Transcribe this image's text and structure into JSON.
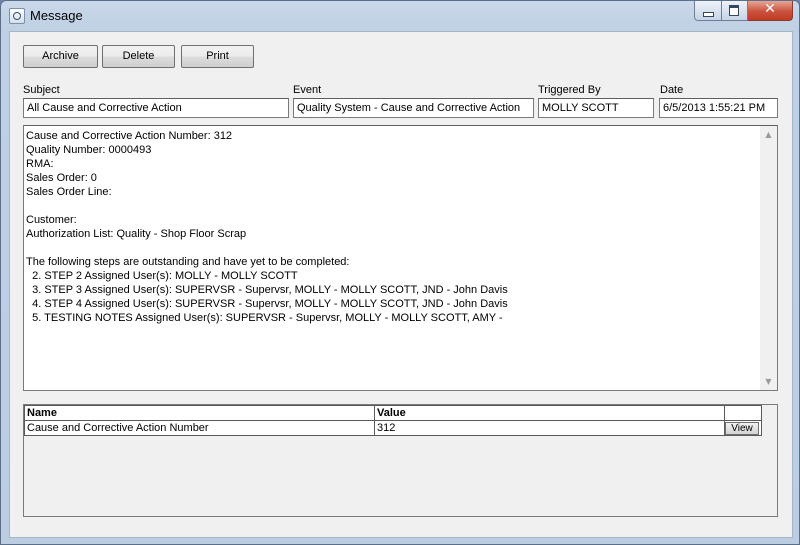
{
  "window": {
    "title": "Message",
    "close_glyph": "✕"
  },
  "toolbar": {
    "archive_label": "Archive",
    "delete_label": "Delete",
    "print_label": "Print"
  },
  "fields": {
    "subject": {
      "label": "Subject",
      "value": "All Cause and Corrective Action"
    },
    "event": {
      "label": "Event",
      "value": "Quality System - Cause and Corrective Action"
    },
    "triggered_by": {
      "label": "Triggered By",
      "value": "MOLLY SCOTT"
    },
    "date": {
      "label": "Date",
      "value": "6/5/2013 1:55:21 PM"
    }
  },
  "body": {
    "text": "Cause and Corrective Action Number: 312\nQuality Number: 0000493\nRMA:\nSales Order: 0\nSales Order Line:\n\nCustomer:\nAuthorization List: Quality - Shop Floor Scrap\n\nThe following steps are outstanding and have yet to be completed:\n  2. STEP 2 Assigned User(s): MOLLY - MOLLY SCOTT\n  3. STEP 3 Assigned User(s): SUPERVSR - Supervsr, MOLLY - MOLLY SCOTT, JND - John Davis\n  4. STEP 4 Assigned User(s): SUPERVSR - Supervsr, MOLLY - MOLLY SCOTT, JND - John Davis\n  5. TESTING NOTES Assigned User(s): SUPERVSR - Supervsr, MOLLY - MOLLY SCOTT, AMY -"
  },
  "grid": {
    "columns": [
      "Name",
      "Value"
    ],
    "rows": [
      {
        "name": "Cause and Corrective Action Number",
        "value": "312",
        "action": "View"
      }
    ]
  },
  "icons": {
    "app": "window-icon",
    "minimize": "minimize-icon",
    "maximize": "maximize-icon",
    "close": "close-icon",
    "scroll_up": "scroll-up-arrow-icon",
    "scroll_down": "scroll-down-arrow-icon"
  }
}
